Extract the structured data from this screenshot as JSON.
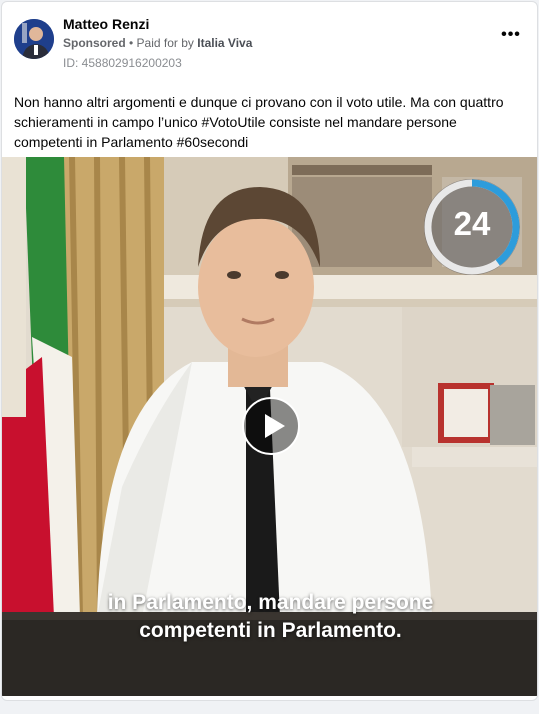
{
  "post": {
    "author": "Matteo Renzi",
    "sponsored": "Sponsored",
    "paid_prefix": " • Paid for by ",
    "payer": "Italia Viva",
    "ad_id": "ID: 458802916200203",
    "text": "Non hanno altri argomenti e dunque ci provano con il voto utile. Ma con quattro schieramenti in campo l’unico #VotoUtile consiste nel mandare persone competenti in Parlamento #60secondi",
    "more_icon": "more-dots-icon"
  },
  "video": {
    "badge_number": "24",
    "badge_progress": 0.4,
    "caption_line1": "in Parlamento, mandare persone",
    "caption_line2": "competenti in Parlamento.",
    "play_icon": "play-icon"
  },
  "colors": {
    "badge_ring": "#2d9cdb",
    "flag_green": "#2e8b3a",
    "flag_red": "#c8102e"
  }
}
